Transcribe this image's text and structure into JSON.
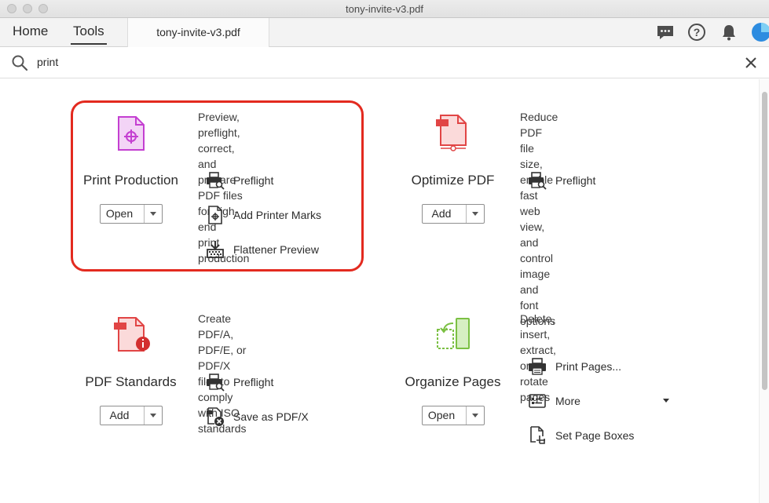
{
  "window": {
    "title": "tony-invite-v3.pdf"
  },
  "header": {
    "tabs": [
      {
        "label": "Home"
      },
      {
        "label": "Tools"
      }
    ],
    "document_tab": "tony-invite-v3.pdf",
    "icons": [
      "chat-icon",
      "help-icon",
      "bell-icon",
      "avatar"
    ]
  },
  "search": {
    "value": "print",
    "icon": "search-icon",
    "clear_icon": "close-icon"
  },
  "tools": [
    {
      "name": "Print Production",
      "button": "Open",
      "description": [
        "Preview, preflight, correct, and",
        "prepare PDF files for high-end",
        "print production"
      ],
      "actions": [
        "Preflight",
        "Add Printer Marks",
        "Flattener Preview"
      ],
      "highlighted": true,
      "color": "#c43fd1"
    },
    {
      "name": "Optimize PDF",
      "button": "Add",
      "description": [
        "Reduce PDF file size, enable",
        "fast web view, and control",
        "image and font options"
      ],
      "actions": [
        "Preflight"
      ],
      "color": "#e14545"
    },
    {
      "name": "PDF Standards",
      "button": "Add",
      "description": [
        "Create PDF/A, PDF/E, or PDF/X",
        "files to comply with ISO",
        "standards"
      ],
      "actions": [
        "Preflight",
        "Save as PDF/X"
      ],
      "color": "#e14545"
    },
    {
      "name": "Organize Pages",
      "button": "Open",
      "description": [
        "Delete, insert, extract, or",
        "rotate pages"
      ],
      "actions": [
        "Print Pages...",
        "More",
        "Set Page Boxes"
      ],
      "color": "#7bc043"
    }
  ],
  "colors": {
    "highlight": "#e32a1f",
    "accent_blue": "#1473e6"
  }
}
